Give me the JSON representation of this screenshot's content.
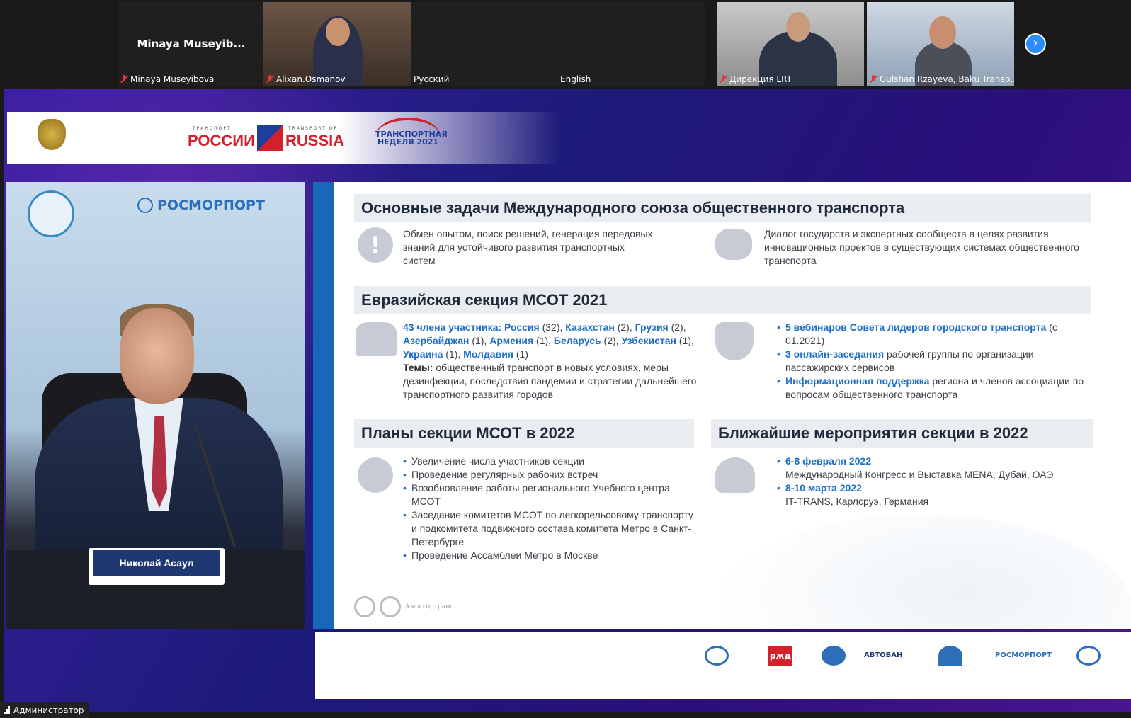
{
  "participants": [
    {
      "display_name": "Minaya  Museyib...",
      "label": "Minaya Museyibova",
      "muted": true,
      "video": false
    },
    {
      "label": "Alixan.Osmanov",
      "muted": true,
      "video": true
    },
    {
      "label": "Русский",
      "muted": false,
      "video": false
    },
    {
      "label": "English",
      "muted": false,
      "video": false
    },
    {
      "label": "Дирекция LRT",
      "muted": true,
      "video": true
    },
    {
      "label": "Gulshan Rzayeva, Baku Transp...",
      "muted": true,
      "video": true
    }
  ],
  "next_page_icon": "chevron-right-icon",
  "header": {
    "rossii": "РОССИИ",
    "russia": "RUSSIA",
    "transport_small": "ТРАНСПОРТ",
    "transport_of_small": "TRANSPORT OF",
    "week_logo": "ТРАНСПОРТНАЯ НЕДЕЛЯ 2021"
  },
  "speaker": {
    "rosmorport": "РОСМОРПОРТ",
    "nameplate": "Николай Асаул"
  },
  "slide": {
    "s1_title": "Основные задачи Международного союза общественного транспорта",
    "s1_left": "Обмен опытом, поиск решений, генерация передовых знаний для устойчивого развития транспортных систем",
    "s1_right": "Диалог государств и экспертных сообществ в целях развития инновационных проектов в существующих системах общественного транспорта",
    "s2_title": "Евразийская секция МСОТ 2021",
    "s2_members": "43 члена участника:",
    "s2_countries": [
      {
        "name": "Россия",
        "n": "(32),"
      },
      {
        "name": "Казахстан",
        "n": "(2),"
      },
      {
        "name": "Грузия",
        "n": "(2),"
      },
      {
        "name": "Азербайджан",
        "n": "(1),"
      },
      {
        "name": "Армения",
        "n": "(1),"
      },
      {
        "name": "Беларусь",
        "n": "(2),"
      },
      {
        "name": "Узбекистан",
        "n": "(1),"
      },
      {
        "name": "Украина",
        "n": "(1),"
      },
      {
        "name": "Молдавия",
        "n": "(1)"
      }
    ],
    "s2_themes_label": "Темы:",
    "s2_themes": "общественный транспорт в новых условиях, меры дезинфекции, последствия пандемии и стратегии дальнейшего транспортного развития городов",
    "s2_right": [
      {
        "hl": "5 вебинаров Совета лидеров городского транспорта",
        "rest": "(с 01.2021)"
      },
      {
        "hl": "3 онлайн-заседания",
        "rest": "рабочей группы по организации пассажирских сервисов"
      },
      {
        "hl": "Информационная поддержка",
        "rest": "региона и членов ассоциации по вопросам общественного транспорта"
      }
    ],
    "s3_title": "Планы секции МСОТ в 2022",
    "s3_items": [
      "Увеличение числа участников секции",
      "Проведение регулярных рабочих встреч",
      "Возобновление работы регионального Учебного центра МСОТ",
      "Заседание комитетов МСОТ по легкорельсовому транспорту и подкомитета подвижного состава комитета Метро в Санкт-Петербурге",
      "Проведение Ассамблеи Метро в Москве"
    ],
    "s4_title": "Ближайшие мероприятия секции в 2022",
    "s4_items": [
      {
        "date": "6-8 февраля 2022",
        "desc": "Международный Конгресс и Выставка MENA, Дубай, ОАЭ"
      },
      {
        "date": "8-10 марта 2022",
        "desc": "IT-TRANS, Карлсруэ, Германия"
      }
    ],
    "footer_tag": "#мосгортранс"
  },
  "partners": [
    "ржд",
    "АВТОБАН",
    "РОСМОРПОРТ"
  ],
  "status": {
    "user": "Администратор"
  }
}
